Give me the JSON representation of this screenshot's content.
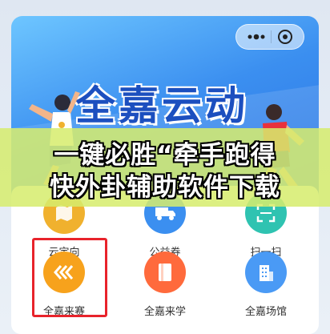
{
  "banner": {
    "title": "全嘉云动"
  },
  "overlay": {
    "line1": "一键必胜“牵手跑得",
    "line2": "快外卦辅助软件下载"
  },
  "grid": {
    "items": [
      {
        "label": "云定向",
        "icon": "map-icon",
        "color": "#f0b12e"
      },
      {
        "label": "公益券",
        "icon": "truck-icon",
        "color": "#3b8ff0"
      },
      {
        "label": "扫一扫",
        "icon": "scan-icon",
        "color": "#2fc3b1"
      },
      {
        "label": "全嘉来赛",
        "icon": "chevrons-left-icon",
        "color": "#f7a21c"
      },
      {
        "label": "全嘉来学",
        "icon": "book-icon",
        "color": "#ff6a3c"
      },
      {
        "label": "全嘉场馆",
        "icon": "building-icon",
        "color": "#4a9af5"
      }
    ]
  },
  "colors": {
    "highlight": "#e8232b",
    "overlay": "#d6ec6e",
    "banner": "#3b8ff0"
  }
}
